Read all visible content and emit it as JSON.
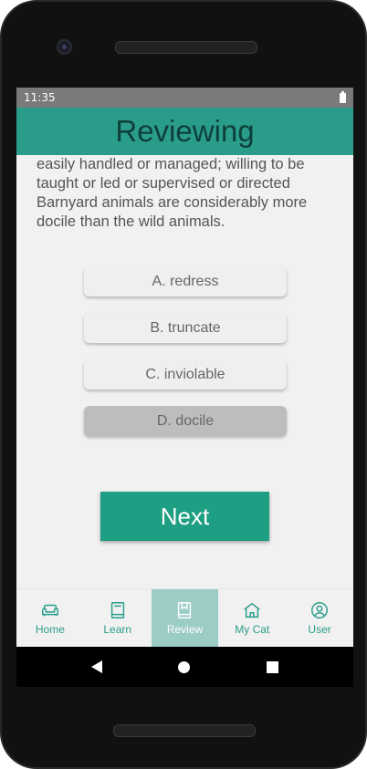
{
  "status": {
    "time": "11:35"
  },
  "appbar": {
    "title": "Reviewing"
  },
  "content": {
    "definition": "easily handled or managed; willing to be taught or led or supervised or directed Barnyard animals are considerably more docile than the wild animals."
  },
  "options": [
    {
      "label": "A. redress",
      "selected": false
    },
    {
      "label": "B. truncate",
      "selected": false
    },
    {
      "label": "C. inviolable",
      "selected": false
    },
    {
      "label": "D. docile",
      "selected": true
    }
  ],
  "next_button": {
    "label": "Next"
  },
  "nav": [
    {
      "label": "Home",
      "icon": "sofa-icon"
    },
    {
      "label": "Learn",
      "icon": "book-icon"
    },
    {
      "label": "Review",
      "icon": "bookmark-book-icon",
      "active": true
    },
    {
      "label": "My Cat",
      "icon": "house-icon"
    },
    {
      "label": "User",
      "icon": "user-circle-icon"
    }
  ],
  "colors": {
    "primary": "#2a9d8a",
    "title_text": "#0e3f3a",
    "button": "#1e9e82",
    "nav_active_bg": "#9cccc6"
  }
}
